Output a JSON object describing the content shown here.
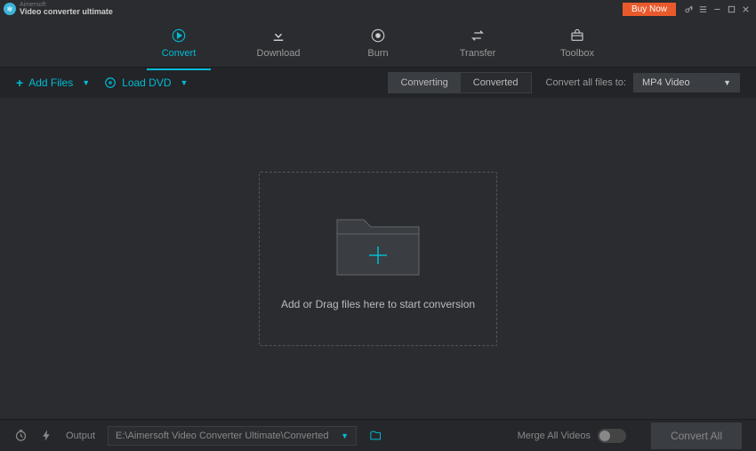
{
  "titlebar": {
    "brand_top": "Aimersoft",
    "brand_bottom": "Video converter ultimate",
    "buy_now": "Buy Now"
  },
  "nav": {
    "convert": "Convert",
    "download": "Download",
    "burn": "Burn",
    "transfer": "Transfer",
    "toolbox": "Toolbox"
  },
  "toolbar": {
    "add_files": "Add Files",
    "load_dvd": "Load DVD",
    "converting": "Converting",
    "converted": "Converted",
    "convert_to_label": "Convert all files to:",
    "format": "MP4 Video"
  },
  "dropzone": {
    "text": "Add or Drag files here to start conversion"
  },
  "footer": {
    "output_label": "Output",
    "output_path": "E:\\Aimersoft Video Converter Ultimate\\Converted",
    "merge_label": "Merge All Videos",
    "convert_all": "Convert All"
  }
}
